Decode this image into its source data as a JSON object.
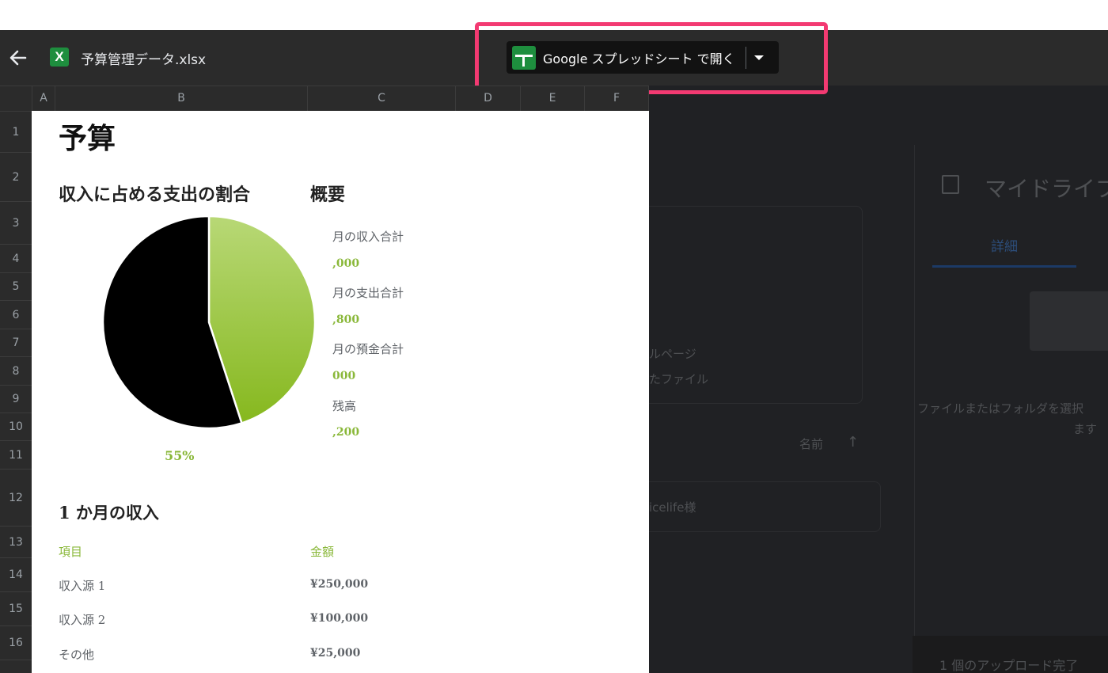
{
  "topbar": {
    "file_icon_letter": "X",
    "file_name": "予算管理データ.xlsx",
    "open_button_label": "Google スプレッドシート で開く",
    "icons": [
      "back-arrow-icon",
      "excel-file-icon",
      "google-sheets-icon",
      "dropdown-arrow-icon"
    ]
  },
  "columns": [
    "A",
    "B",
    "C",
    "D",
    "E",
    "F"
  ],
  "rows": [
    "1",
    "2",
    "3",
    "4",
    "5",
    "6",
    "7",
    "8",
    "9",
    "10",
    "11",
    "12",
    "13",
    "14",
    "15",
    "16"
  ],
  "sheet": {
    "title": "予算",
    "chart_title": "収入に占める支出の割合",
    "summary_title": "概要",
    "pie_percentage": "55%",
    "summary": [
      {
        "label": "月の収入合計",
        "value": ",000"
      },
      {
        "label": "月の支出合計",
        "value": ",800"
      },
      {
        "label": "月の預金合計",
        "value": "000"
      },
      {
        "label": "残高",
        "value": ",200"
      }
    ],
    "income_title": "1 か月の収入",
    "income_table": {
      "headers": [
        "項目",
        "金額"
      ],
      "rows": [
        [
          "収入源 1",
          "¥250,000"
        ],
        [
          "収入源 2",
          "¥100,000"
        ],
        [
          "その他",
          "¥25,000"
        ]
      ]
    }
  },
  "chart_data": {
    "type": "pie",
    "values": [
      55,
      45
    ],
    "colors": [
      "#000000",
      "#9bc94a"
    ],
    "labels": [
      "55%"
    ]
  },
  "background": {
    "mydrive": "マイドライブ",
    "details_tab": "詳細",
    "page_text": "ルページ",
    "file_text": "たファイル",
    "name_sort": "名前",
    "user_text": "icelife様",
    "select_hint_1": "ファイルまたはフォルダを選択",
    "select_hint_2": "ます",
    "upload_status": "1 個のアップロード完了"
  },
  "colors": {
    "highlight": "#f33a72",
    "accent_green": "#8ab83a",
    "sheets_green": "#1e8e3e"
  }
}
